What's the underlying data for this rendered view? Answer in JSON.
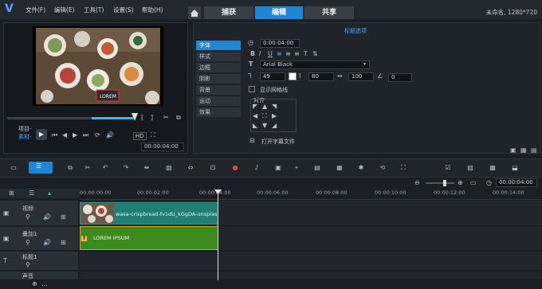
{
  "menu": [
    "文件(F)",
    "编辑(E)",
    "工具(T)",
    "设置(S)",
    "帮助(H)"
  ],
  "tabs": [
    "捕获",
    "编辑",
    "共享"
  ],
  "project_info": "未命名, 1280*720",
  "preview": {
    "mode_project": "项目-",
    "mode_clip": "素材-",
    "zoom_label": "HD",
    "timecode": "00:00:04:00"
  },
  "options": {
    "title": "标题选项",
    "side_tabs": [
      "字体",
      "样式",
      "边框",
      "阴影",
      "背景",
      "运动",
      "效果"
    ],
    "duration": "0:00:04:00",
    "font_name": "Arial Black",
    "font_size": "49",
    "line_spacing": "80",
    "tracking": "100",
    "angle": "0",
    "show_grid_label": "显示网格线",
    "align_label": "对齐",
    "open_subtitle_label": "打开字幕文件",
    "accent_color": "#1f86d6"
  },
  "timeline": {
    "ticks": [
      "00:00:00:00",
      "00:00:02:00",
      "00:00:04:00",
      "00:00:06:00",
      "00:00:08:00",
      "00:00:10:00",
      "00:00:12:00",
      "00:00:14:00"
    ],
    "timecode": "00:00:04:00",
    "tracks": [
      {
        "name": "视频"
      },
      {
        "name": "叠加1"
      },
      {
        "name": "标题1"
      },
      {
        "name": "声音"
      }
    ],
    "video_clip_label": "wasa-crispbread-fv1dU_kGgDA-unsplash.jp",
    "title_clip_label": "LOREM IPSUM",
    "title_clip_color": "#3a8a1c",
    "video_clip_color": "#1e7f72"
  }
}
